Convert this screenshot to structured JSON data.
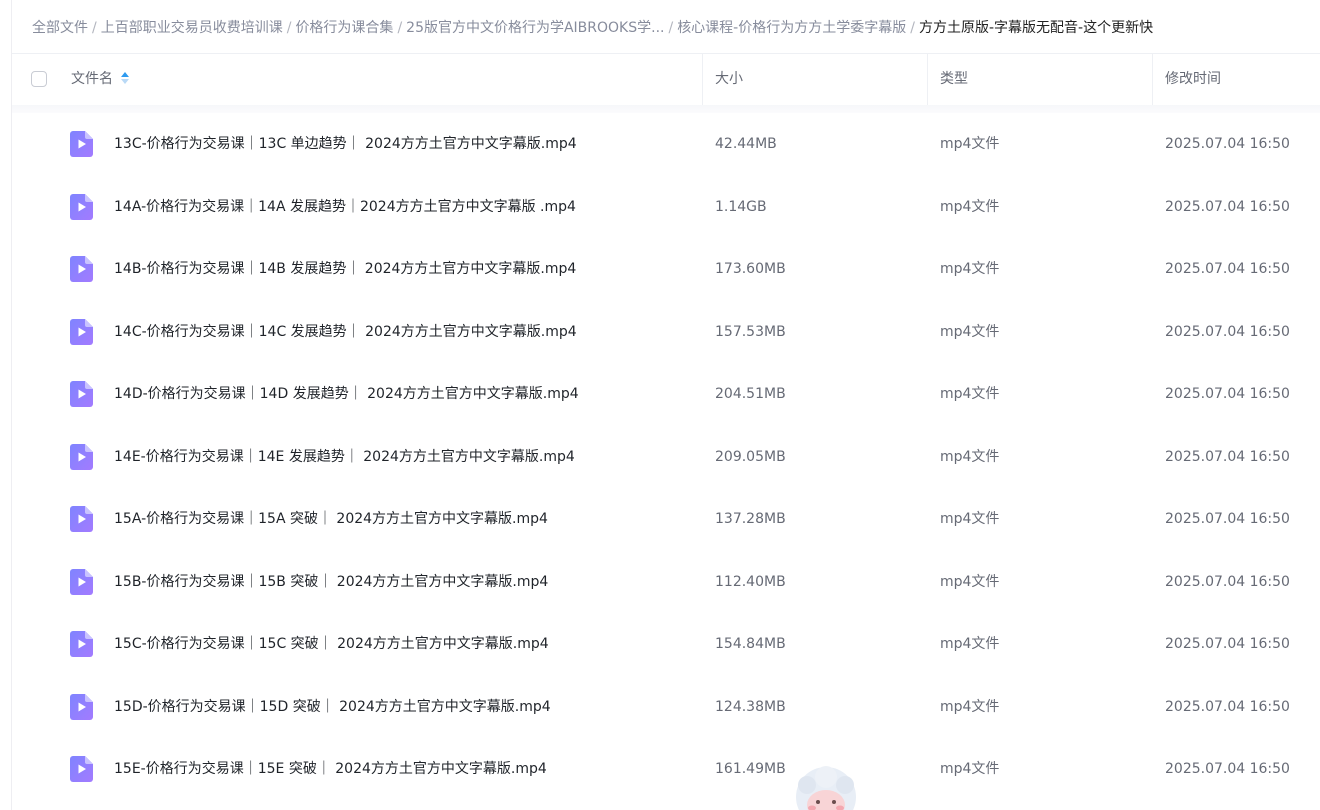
{
  "breadcrumb": [
    {
      "label": "全部文件"
    },
    {
      "label": "上百部职业交易员收费培训课"
    },
    {
      "label": "价格行为课合集"
    },
    {
      "label": "25版官方中文价格行为学AIBROOKS学..."
    },
    {
      "label": "核心课程-价格行为方方土学委字幕版"
    }
  ],
  "breadcrumb_current": "方方土原版-字幕版无配音-这个更新快",
  "breadcrumb_separator": "/",
  "table": {
    "columns": {
      "name": "文件名",
      "size": "大小",
      "type": "类型",
      "modified": "修改时间"
    },
    "sort": {
      "column": "name",
      "direction": "asc"
    },
    "rows": [
      {
        "name": "13C-价格行为交易课｜13C 单边趋势｜ 2024方方土官方中文字幕版.mp4",
        "size": "42.44MB",
        "type": "mp4文件",
        "modified": "2025.07.04 16:50"
      },
      {
        "name": "14A-价格行为交易课｜14A 发展趋势｜2024方方土官方中文字幕版 .mp4",
        "size": "1.14GB",
        "type": "mp4文件",
        "modified": "2025.07.04 16:50"
      },
      {
        "name": "14B-价格行为交易课｜14B 发展趋势｜ 2024方方土官方中文字幕版.mp4",
        "size": "173.60MB",
        "type": "mp4文件",
        "modified": "2025.07.04 16:50"
      },
      {
        "name": "14C-价格行为交易课｜14C 发展趋势｜ 2024方方土官方中文字幕版.mp4",
        "size": "157.53MB",
        "type": "mp4文件",
        "modified": "2025.07.04 16:50"
      },
      {
        "name": "14D-价格行为交易课｜14D 发展趋势｜ 2024方方土官方中文字幕版.mp4",
        "size": "204.51MB",
        "type": "mp4文件",
        "modified": "2025.07.04 16:50"
      },
      {
        "name": "14E-价格行为交易课｜14E 发展趋势｜ 2024方方土官方中文字幕版.mp4",
        "size": "209.05MB",
        "type": "mp4文件",
        "modified": "2025.07.04 16:50"
      },
      {
        "name": "15A-价格行为交易课｜15A 突破｜ 2024方方土官方中文字幕版.mp4",
        "size": "137.28MB",
        "type": "mp4文件",
        "modified": "2025.07.04 16:50"
      },
      {
        "name": "15B-价格行为交易课｜15B 突破｜ 2024方方土官方中文字幕版.mp4",
        "size": "112.40MB",
        "type": "mp4文件",
        "modified": "2025.07.04 16:50"
      },
      {
        "name": "15C-价格行为交易课｜15C 突破｜ 2024方方土官方中文字幕版.mp4",
        "size": "154.84MB",
        "type": "mp4文件",
        "modified": "2025.07.04 16:50"
      },
      {
        "name": "15D-价格行为交易课｜15D 突破｜ 2024方方土官方中文字幕版.mp4",
        "size": "124.38MB",
        "type": "mp4文件",
        "modified": "2025.07.04 16:50"
      },
      {
        "name": "15E-价格行为交易课｜15E 突破｜ 2024方方土官方中文字幕版.mp4",
        "size": "161.49MB",
        "type": "mp4文件",
        "modified": "2025.07.04 16:50"
      }
    ]
  },
  "icons": {
    "file": "video-file-icon",
    "sort": "sort-ascending-icon",
    "mascot": "mascot-avatar-icon"
  },
  "colors": {
    "file_icon_gradient": [
      "#7f84ff",
      "#a37bff"
    ],
    "sort_active": "#2e9bf0",
    "text_primary": "#1f2329",
    "text_secondary": "#666a75",
    "breadcrumb_muted": "#878c9c"
  }
}
